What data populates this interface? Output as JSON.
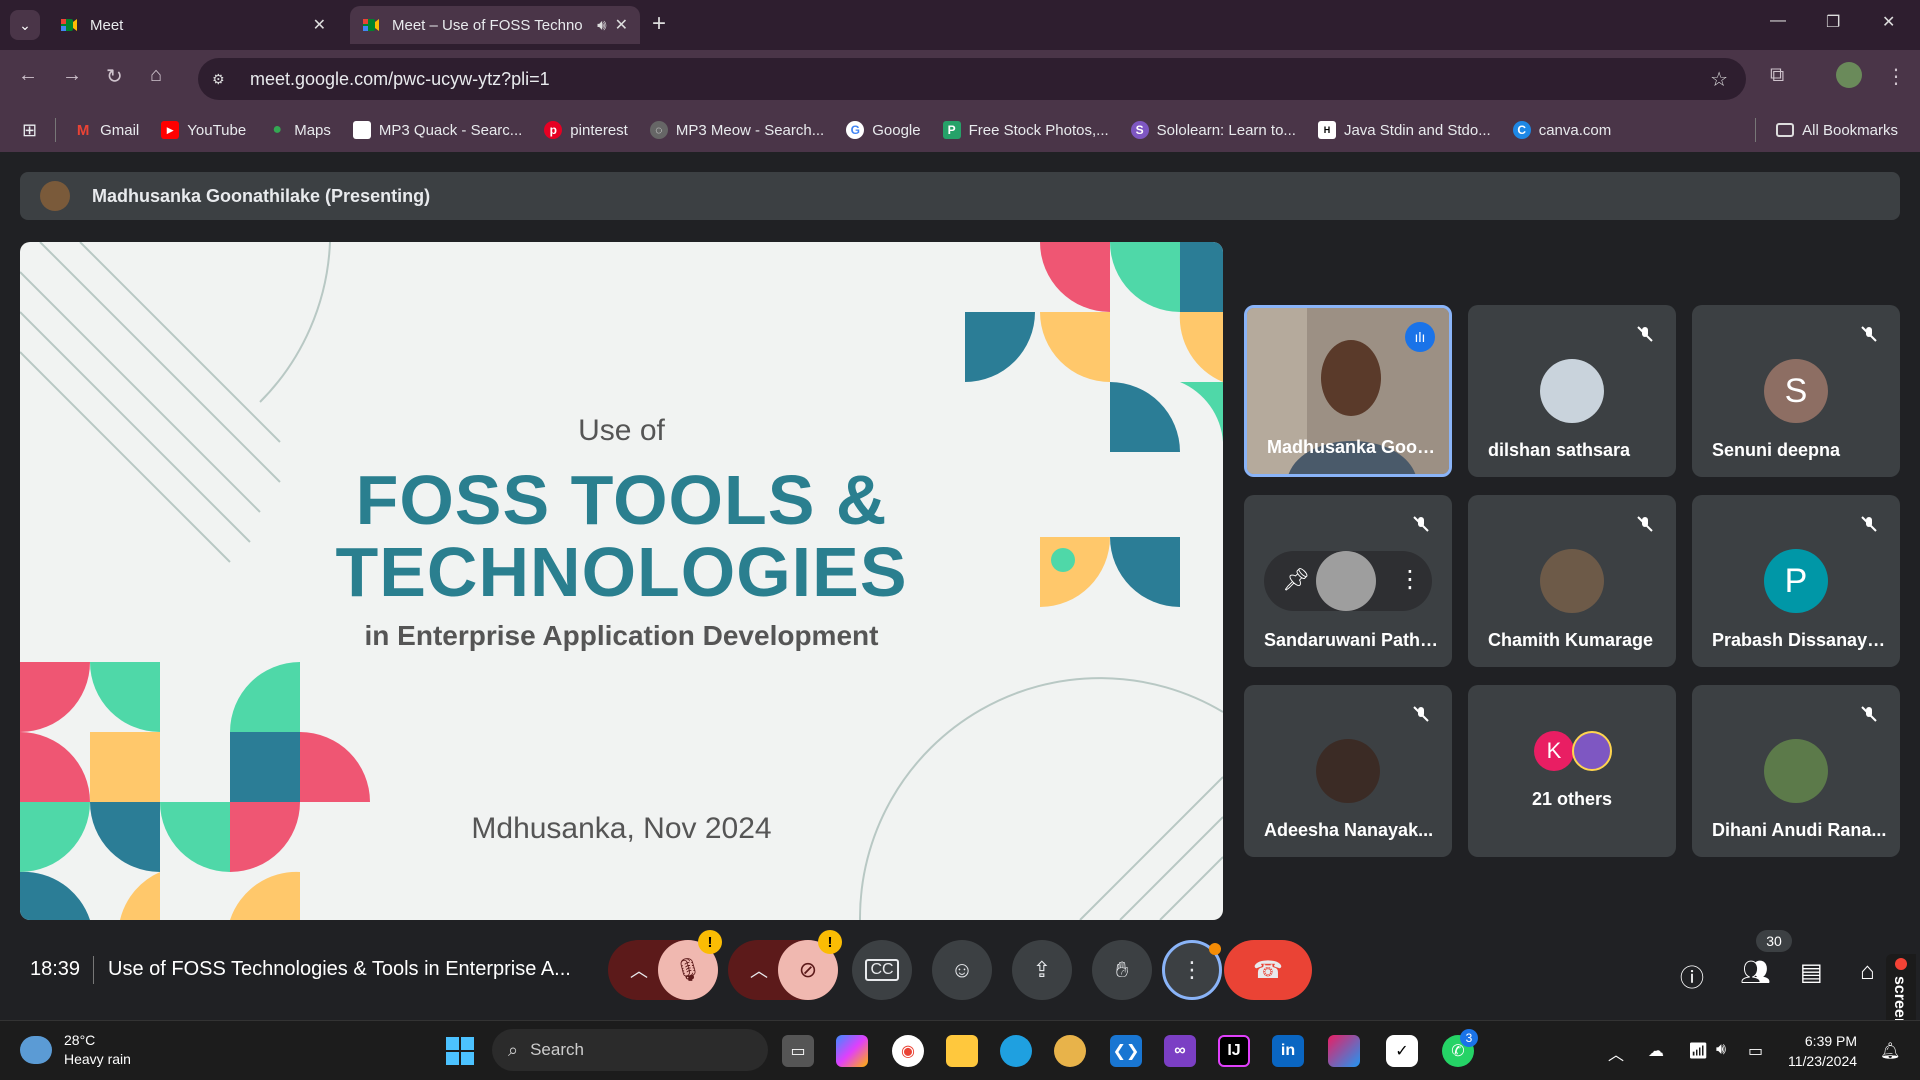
{
  "browser": {
    "tabs": [
      {
        "title": "Meet",
        "active": false
      },
      {
        "title": "Meet – Use of FOSS Techno",
        "active": true
      }
    ],
    "url": "meet.google.com/pwc-ucyw-ytz?pli=1",
    "bookmarks": [
      "Gmail",
      "YouTube",
      "Maps",
      "MP3 Quack - Searc...",
      "pinterest",
      "MP3 Meow - Search...",
      "Google",
      "Free Stock Photos,...",
      "Sololearn: Learn to...",
      "Java Stdin and Stdo...",
      "canva.com"
    ],
    "all_bookmarks": "All Bookmarks"
  },
  "meet": {
    "presenter_banner": "Madhusanka Goonathilake (Presenting)",
    "slide": {
      "line1": "Use of",
      "line2": "FOSS TOOLS &",
      "line3": "TECHNOLOGIES",
      "line4": "in Enterprise Application Development",
      "footer": "Mdhusanka, Nov 2024"
    },
    "participants": [
      {
        "name": "Madhusanka Goon...",
        "kind": "video",
        "speaking": true
      },
      {
        "name": "dilshan sathsara",
        "kind": "photo",
        "color": "#c9d3dc"
      },
      {
        "name": "Senuni deepna",
        "kind": "letter",
        "letter": "S",
        "color": "#8d6e63"
      },
      {
        "name": "Sandaruwani Pathi...",
        "kind": "pinned",
        "color": "#9e9e9e"
      },
      {
        "name": "Chamith Kumarage",
        "kind": "photo",
        "color": "#6d5a48"
      },
      {
        "name": "Prabash Dissanaya...",
        "kind": "letter",
        "letter": "P",
        "color": "#0097a7"
      },
      {
        "name": "Adeesha Nanayak...",
        "kind": "photo",
        "color": "#3b2b25"
      },
      {
        "name": "21 others",
        "kind": "others",
        "letter": "K",
        "color": "#e91e63"
      },
      {
        "name": "Dihani Anudi Rana...",
        "kind": "photo",
        "color": "#5c7a4a"
      }
    ],
    "time": "18:39",
    "meeting_title": "Use of FOSS Technologies & Tools in Enterprise A...",
    "people_count": "30"
  },
  "taskbar": {
    "temp": "28°C",
    "condition": "Heavy rain",
    "search": "Search",
    "clock_time": "6:39 PM",
    "clock_date": "11/23/2024",
    "whatsapp_badge": "3",
    "screenrec_label": "screenrec"
  }
}
